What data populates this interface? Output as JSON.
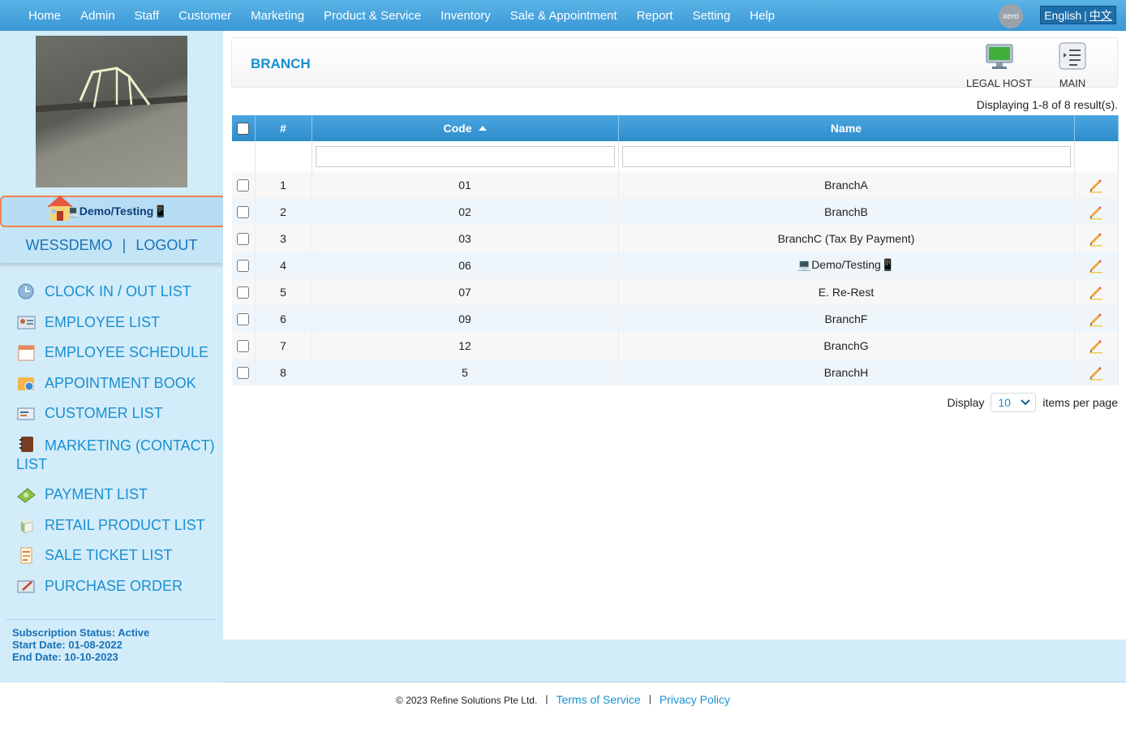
{
  "nav": {
    "items": [
      "Home",
      "Admin",
      "Staff",
      "Customer",
      "Marketing",
      "Product & Service",
      "Inventory",
      "Sale & Appointment",
      "Report",
      "Setting",
      "Help"
    ],
    "xero": "xero",
    "lang_en": "English",
    "lang_sep": "|",
    "lang_cn": "中文"
  },
  "sidebar": {
    "branch": "💻Demo/Testing📱",
    "user": "WESSDEMO",
    "user_sep": "|",
    "logout": "LOGOUT",
    "menu": [
      {
        "label": "CLOCK IN / OUT LIST",
        "icon": "clock-icon"
      },
      {
        "label": "EMPLOYEE LIST",
        "icon": "employee-card-icon"
      },
      {
        "label": "EMPLOYEE SCHEDULE",
        "icon": "calendar-icon"
      },
      {
        "label": "APPOINTMENT BOOK",
        "icon": "appointment-book-icon"
      },
      {
        "label": "CUSTOMER LIST",
        "icon": "customer-list-icon"
      },
      {
        "label": "MARKETING (CONTACT) LIST",
        "icon": "contact-book-icon"
      },
      {
        "label": "PAYMENT LIST",
        "icon": "money-icon"
      },
      {
        "label": "RETAIL PRODUCT LIST",
        "icon": "product-box-icon"
      },
      {
        "label": "SALE TICKET LIST",
        "icon": "sale-ticket-icon"
      },
      {
        "label": "PURCHASE ORDER",
        "icon": "purchase-order-icon"
      }
    ],
    "subscription": {
      "status": "Subscription Status: Active",
      "start": "Start Date: 01-08-2022",
      "end": "End Date: 10-10-2023"
    }
  },
  "main": {
    "title": "BRANCH",
    "legal_host": "LEGAL HOST",
    "main_label": "MAIN",
    "result_count": "Displaying 1-8 of 8 result(s).",
    "columns": {
      "num": "#",
      "code": "Code",
      "name": "Name"
    },
    "rows": [
      {
        "num": "1",
        "code": "01",
        "name": "BranchA"
      },
      {
        "num": "2",
        "code": "02",
        "name": "BranchB"
      },
      {
        "num": "3",
        "code": "03",
        "name": "BranchC (Tax By Payment)"
      },
      {
        "num": "4",
        "code": "06",
        "name": "💻Demo/Testing📱"
      },
      {
        "num": "5",
        "code": "07",
        "name": "E. Re-Rest"
      },
      {
        "num": "6",
        "code": "09",
        "name": "BranchF"
      },
      {
        "num": "7",
        "code": "12",
        "name": "BranchG"
      },
      {
        "num": "8",
        "code": "5",
        "name": "BranchH"
      }
    ],
    "pager": {
      "display": "Display",
      "per_page": "10",
      "items_per_page": "items per page"
    }
  },
  "footer": {
    "copyright": "© 2023 Refine Solutions Pte Ltd.",
    "sep": "|",
    "terms": "Terms of Service",
    "privacy": "Privacy Policy"
  }
}
